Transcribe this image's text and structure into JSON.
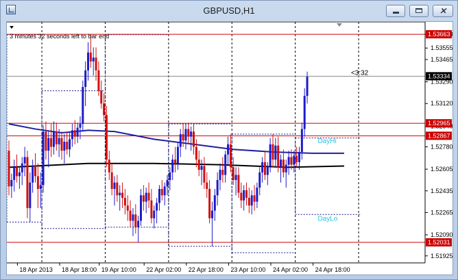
{
  "window": {
    "title": "GBPUSD,H1"
  },
  "chart_data": {
    "type": "candlestick",
    "symbol": "GBPUSD",
    "timeframe": "H1",
    "info_text": "3 minutes 32 seconds left to bar end",
    "countdown": "<3:32",
    "ylim": [
      1.5187,
      1.5376
    ],
    "y_ticks": [
      "1.53663",
      "1.53555",
      "1.53465",
      "1.53290",
      "1.53120",
      "1.52940",
      "1.52780",
      "1.52605",
      "1.52435",
      "1.52265",
      "1.52090",
      "1.51925"
    ],
    "x_labels": [
      "18 Apr 2013",
      "18 Apr 18:00",
      "19 Apr 10:00",
      "22 Apr 02:00",
      "22 Apr 18:00",
      "23 Apr 10:00",
      "24 Apr 02:00",
      "24 Apr 18:00"
    ],
    "x_label_bars": [
      4,
      20,
      35,
      52,
      68,
      84,
      100,
      116
    ],
    "day_separator_bars": [
      13,
      37,
      61,
      85,
      109,
      133
    ],
    "price_lines": [
      {
        "label": "1.53663",
        "value": 1.53663,
        "color": "#cc0000"
      },
      {
        "label": "1.52965",
        "value": 1.52965,
        "color": "#cc0000"
      },
      {
        "label": "1.52867",
        "value": 1.52867,
        "color": "#cc0000"
      },
      {
        "label": "1.52031",
        "value": 1.52031,
        "color": "#cc0000"
      }
    ],
    "current_price": {
      "label": "1.53334",
      "value": 1.53334
    },
    "day_labels": [
      {
        "text": "DayHi",
        "bar": 117,
        "value": 1.5281
      },
      {
        "text": "DayLo",
        "bar": 117,
        "value": 1.522
      }
    ],
    "candles": [
      [
        1.5275,
        1.5283,
        1.524,
        1.5247
      ],
      [
        1.5247,
        1.5257,
        1.5238,
        1.5252
      ],
      [
        1.5252,
        1.5268,
        1.5243,
        1.5262
      ],
      [
        1.5262,
        1.5272,
        1.525,
        1.5255
      ],
      [
        1.5255,
        1.5263,
        1.5245,
        1.5258
      ],
      [
        1.5258,
        1.527,
        1.5248,
        1.5265
      ],
      [
        1.5265,
        1.5278,
        1.5255,
        1.527
      ],
      [
        1.527,
        1.5275,
        1.5222,
        1.523
      ],
      [
        1.523,
        1.5258,
        1.5219,
        1.525
      ],
      [
        1.525,
        1.5268,
        1.5242,
        1.5263
      ],
      [
        1.5263,
        1.5273,
        1.525,
        1.5255
      ],
      [
        1.5255,
        1.5265,
        1.523,
        1.5245
      ],
      [
        1.5245,
        1.5258,
        1.523,
        1.5248
      ],
      [
        1.5248,
        1.5295,
        1.5242,
        1.529
      ],
      [
        1.529,
        1.5298,
        1.5268,
        1.5275
      ],
      [
        1.5275,
        1.529,
        1.5262,
        1.5285
      ],
      [
        1.5285,
        1.5296,
        1.527,
        1.5278
      ],
      [
        1.5278,
        1.5298,
        1.5272,
        1.529
      ],
      [
        1.529,
        1.5297,
        1.5275,
        1.528
      ],
      [
        1.528,
        1.5292,
        1.527,
        1.5285
      ],
      [
        1.5285,
        1.529,
        1.5268,
        1.5275
      ],
      [
        1.5275,
        1.5288,
        1.5265,
        1.5282
      ],
      [
        1.5282,
        1.529,
        1.5272,
        1.5276
      ],
      [
        1.5276,
        1.5289,
        1.527,
        1.5284
      ],
      [
        1.5284,
        1.5296,
        1.5278,
        1.5291
      ],
      [
        1.5291,
        1.5299,
        1.528,
        1.5286
      ],
      [
        1.5286,
        1.5297,
        1.5281,
        1.5293
      ],
      [
        1.5293,
        1.5302,
        1.5284,
        1.5296
      ],
      [
        1.5296,
        1.533,
        1.529,
        1.5325
      ],
      [
        1.5325,
        1.5345,
        1.531,
        1.5338
      ],
      [
        1.5338,
        1.536,
        1.533,
        1.5352
      ],
      [
        1.5352,
        1.5366,
        1.534,
        1.5345
      ],
      [
        1.5345,
        1.5356,
        1.5334,
        1.5348
      ],
      [
        1.5348,
        1.5356,
        1.533,
        1.5338
      ],
      [
        1.5338,
        1.5345,
        1.5318,
        1.5322
      ],
      [
        1.5322,
        1.533,
        1.5308,
        1.5312
      ],
      [
        1.5312,
        1.532,
        1.5298,
        1.5303
      ],
      [
        1.5303,
        1.531,
        1.5262,
        1.5268
      ],
      [
        1.5268,
        1.5275,
        1.5252,
        1.5258
      ],
      [
        1.5258,
        1.5265,
        1.524,
        1.5245
      ],
      [
        1.5245,
        1.5255,
        1.5232,
        1.525
      ],
      [
        1.525,
        1.5256,
        1.5235,
        1.524
      ],
      [
        1.524,
        1.5248,
        1.5228,
        1.5242
      ],
      [
        1.5242,
        1.525,
        1.523,
        1.5238
      ],
      [
        1.5238,
        1.5245,
        1.5225,
        1.5232
      ],
      [
        1.5232,
        1.524,
        1.522,
        1.5228
      ],
      [
        1.5228,
        1.5236,
        1.5215,
        1.522
      ],
      [
        1.522,
        1.523,
        1.5208,
        1.5225
      ],
      [
        1.5225,
        1.5233,
        1.521,
        1.5215
      ],
      [
        1.5215,
        1.5224,
        1.5203,
        1.522
      ],
      [
        1.522,
        1.5245,
        1.5216,
        1.524
      ],
      [
        1.524,
        1.5248,
        1.5228,
        1.5235
      ],
      [
        1.5235,
        1.5246,
        1.5226,
        1.5242
      ],
      [
        1.5242,
        1.525,
        1.523,
        1.5236
      ],
      [
        1.5236,
        1.5245,
        1.5218,
        1.5222
      ],
      [
        1.5222,
        1.5232,
        1.5214,
        1.5228
      ],
      [
        1.5228,
        1.5238,
        1.5218,
        1.5234
      ],
      [
        1.5234,
        1.5248,
        1.5228,
        1.5245
      ],
      [
        1.5245,
        1.5252,
        1.5236,
        1.524
      ],
      [
        1.524,
        1.525,
        1.5232,
        1.5247
      ],
      [
        1.5247,
        1.5256,
        1.524,
        1.5252
      ],
      [
        1.5252,
        1.5262,
        1.5244,
        1.5258
      ],
      [
        1.5258,
        1.5272,
        1.5252,
        1.5268
      ],
      [
        1.5268,
        1.5278,
        1.5258,
        1.5265
      ],
      [
        1.5265,
        1.5282,
        1.526,
        1.5278
      ],
      [
        1.5278,
        1.5292,
        1.527,
        1.5288
      ],
      [
        1.5288,
        1.5296,
        1.5278,
        1.5283
      ],
      [
        1.5283,
        1.5296,
        1.5276,
        1.5292
      ],
      [
        1.5292,
        1.5297,
        1.528,
        1.5286
      ],
      [
        1.5286,
        1.5294,
        1.5275,
        1.529
      ],
      [
        1.529,
        1.5296,
        1.5272,
        1.5278
      ],
      [
        1.5278,
        1.5284,
        1.5262,
        1.5268
      ],
      [
        1.5268,
        1.5275,
        1.5255,
        1.526
      ],
      [
        1.526,
        1.5268,
        1.5248,
        1.5263
      ],
      [
        1.5263,
        1.527,
        1.5245,
        1.525
      ],
      [
        1.525,
        1.5258,
        1.5238,
        1.5245
      ],
      [
        1.5245,
        1.5252,
        1.5218,
        1.5222
      ],
      [
        1.5222,
        1.5235,
        1.52,
        1.5228
      ],
      [
        1.5228,
        1.5245,
        1.522,
        1.524
      ],
      [
        1.524,
        1.5258,
        1.5232,
        1.5252
      ],
      [
        1.5252,
        1.5265,
        1.5244,
        1.526
      ],
      [
        1.526,
        1.527,
        1.525,
        1.5256
      ],
      [
        1.5256,
        1.5275,
        1.525,
        1.5272
      ],
      [
        1.5272,
        1.5286,
        1.5264,
        1.528
      ],
      [
        1.528,
        1.5288,
        1.5258,
        1.5262
      ],
      [
        1.5262,
        1.527,
        1.5248,
        1.5252
      ],
      [
        1.5252,
        1.5262,
        1.524,
        1.5256
      ],
      [
        1.5256,
        1.5262,
        1.5238,
        1.5242
      ],
      [
        1.5242,
        1.525,
        1.523,
        1.5236
      ],
      [
        1.5236,
        1.5248,
        1.5228,
        1.5244
      ],
      [
        1.5244,
        1.525,
        1.5232,
        1.5238
      ],
      [
        1.5238,
        1.5246,
        1.5226,
        1.5232
      ],
      [
        1.5232,
        1.5244,
        1.5225,
        1.524
      ],
      [
        1.524,
        1.5248,
        1.5228,
        1.5235
      ],
      [
        1.5235,
        1.525,
        1.523,
        1.5246
      ],
      [
        1.5246,
        1.5262,
        1.524,
        1.5258
      ],
      [
        1.5258,
        1.527,
        1.525,
        1.5266
      ],
      [
        1.5266,
        1.5274,
        1.5252,
        1.5256
      ],
      [
        1.5256,
        1.5266,
        1.5248,
        1.5263
      ],
      [
        1.5263,
        1.5285,
        1.5258,
        1.528
      ],
      [
        1.528,
        1.5288,
        1.5262,
        1.5268
      ],
      [
        1.5268,
        1.5285,
        1.5262,
        1.5279
      ],
      [
        1.5279,
        1.5286,
        1.5258,
        1.5262
      ],
      [
        1.5262,
        1.5272,
        1.525,
        1.5268
      ],
      [
        1.5268,
        1.5276,
        1.5254,
        1.5258
      ],
      [
        1.5258,
        1.5268,
        1.5246,
        1.5264
      ],
      [
        1.5264,
        1.5275,
        1.5256,
        1.527
      ],
      [
        1.527,
        1.5276,
        1.526,
        1.5264
      ],
      [
        1.5264,
        1.5275,
        1.5258,
        1.5271
      ],
      [
        1.5271,
        1.5278,
        1.5262,
        1.5266
      ],
      [
        1.5266,
        1.5278,
        1.526,
        1.5274
      ],
      [
        1.5274,
        1.5297,
        1.5268,
        1.5292
      ],
      [
        1.5292,
        1.5324,
        1.5286,
        1.5318
      ],
      [
        1.5318,
        1.5337,
        1.5312,
        1.5333
      ]
    ],
    "series": [
      {
        "type": "line",
        "color": "#1f1fa0",
        "values": [
          [
            0,
            1.5296
          ],
          [
            10,
            1.5292
          ],
          [
            20,
            1.5289
          ],
          [
            30,
            1.5291
          ],
          [
            40,
            1.529
          ],
          [
            55,
            1.5284
          ],
          [
            70,
            1.528
          ],
          [
            85,
            1.5276
          ],
          [
            100,
            1.5274
          ],
          [
            115,
            1.5273
          ],
          [
            127,
            1.5273
          ]
        ]
      },
      {
        "type": "line",
        "color": "#000000",
        "values": [
          [
            0,
            1.5262
          ],
          [
            30,
            1.5265
          ],
          [
            55,
            1.5265
          ],
          [
            80,
            1.5264
          ],
          [
            105,
            1.5262
          ],
          [
            127,
            1.5263
          ]
        ]
      }
    ],
    "day_boxes": [
      {
        "from": -1,
        "to": 13,
        "hi": 1.5366,
        "lo": 1.5219
      },
      {
        "from": 13,
        "to": 37,
        "hi": 1.5322,
        "lo": 1.5214
      },
      {
        "from": 37,
        "to": 61,
        "hi": 1.5366,
        "lo": 1.5215
      },
      {
        "from": 61,
        "to": 85,
        "hi": 1.5296,
        "lo": 1.52
      },
      {
        "from": 85,
        "to": 109,
        "hi": 1.5288,
        "lo": 1.5195
      },
      {
        "from": 109,
        "to": 134,
        "hi": 1.5285,
        "lo": 1.5225
      }
    ]
  }
}
